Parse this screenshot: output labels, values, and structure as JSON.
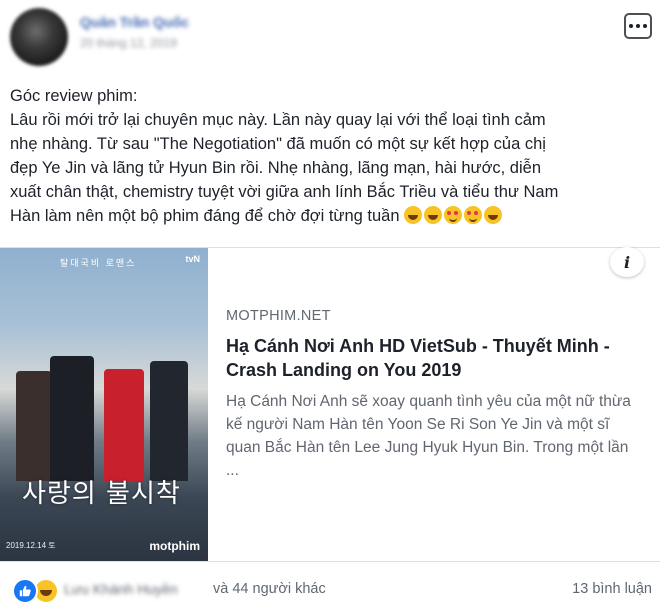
{
  "header": {
    "author_name": "Quân Trần Quốc",
    "post_date": "20 tháng 12, 2019"
  },
  "post": {
    "lines": [
      "Góc review phim:",
      "Lâu rồi mới trở lại chuyên mục này. Lần này quay lại với thể loại tình cảm",
      "nhẹ nhàng. Từ sau \"The Negotiation\" đã muốn có một sự kết hợp của chị",
      "đẹp Ye Jin và lãng tử Hyun Bin rồi. Nhẹ nhàng, lãng mạn, hài hước, diễn",
      "xuất chân thật, chemistry tuyệt vời giữa anh lính Bắc Triều và tiểu thư Nam",
      "Hàn làm nên một bộ phim đáng để chờ đợi từng tuần"
    ],
    "emojis": [
      "rofl-emoji",
      "rofl-emoji",
      "smiling-hearts-emoji",
      "smiling-hearts-emoji",
      "joy-emoji"
    ]
  },
  "link_card": {
    "domain": "MOTPHIM.NET",
    "title": "Hạ Cánh Nơi Anh HD VietSub - Thuyết Minh - Crash Landing on You 2019",
    "description": "Hạ Cánh Nơi Anh sẽ xoay quanh tình yêu của một nữ thừa kế người Nam Hàn tên Yoon Se Ri Son Ye Jin và một sĩ quan Bắc Hàn tên Lee Jung Hyuk Hyun Bin. Trong một lần ...",
    "info_icon": "i",
    "poster": {
      "korean_title": "사랑의 불시착",
      "top_tag": "탈대국비 로맨스",
      "channel": "tvN",
      "watermark": "motphim",
      "date": "2019.12.14 토"
    }
  },
  "footer": {
    "liker_name": "Lưu Khánh Huyền",
    "others_text": "và 44 người khác",
    "comments_text": "13 bình luận"
  },
  "colors": {
    "link_blue": "#4267b2",
    "secondary_text": "#606770",
    "like_blue": "#1877f2"
  }
}
